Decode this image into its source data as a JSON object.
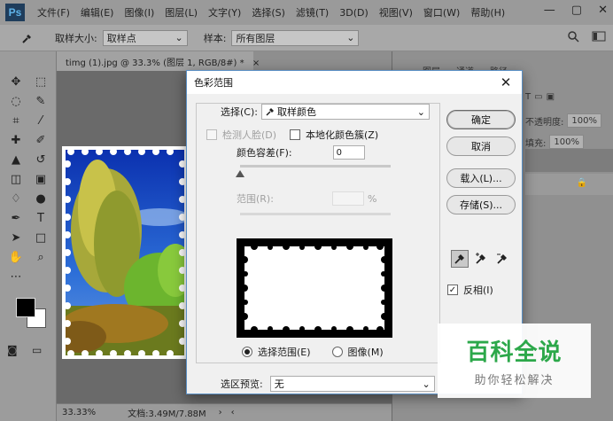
{
  "menubar": {
    "logo": "Ps",
    "items": [
      "文件(F)",
      "编辑(E)",
      "图像(I)",
      "图层(L)",
      "文字(Y)",
      "选择(S)",
      "滤镜(T)",
      "3D(D)",
      "视图(V)",
      "窗口(W)",
      "帮助(H)"
    ],
    "window_controls": [
      "—",
      "▢",
      "✕"
    ]
  },
  "optionsbar": {
    "sample_size_label": "取样大小:",
    "sample_size_value": "取样点",
    "sample_label": "样本:",
    "sample_value": "所有图层"
  },
  "document": {
    "tab_title": "timg (1).jpg @ 33.3% (图层 1, RGB/8#) *",
    "zoom": "33.33%",
    "doc_info": "文档:3.49M/7.88M"
  },
  "panels": {
    "tabs": [
      "图层",
      "通道",
      "路径"
    ],
    "opacity_label": "不透明度:",
    "opacity_value": "100%",
    "fill_label": "填充:",
    "fill_value": "100%"
  },
  "dialog": {
    "title": "色彩范围",
    "select_label": "选择(C):",
    "select_value": "取样颜色",
    "detect_faces_label": "检测人脸(D)",
    "localized_label": "本地化颜色簇(Z)",
    "fuzziness_label": "颜色容差(F):",
    "fuzziness_value": "0",
    "range_label": "范围(R):",
    "range_unit": "%",
    "radio_selection": "选择范围(E)",
    "radio_image": "图像(M)",
    "preview_label": "选区预览:",
    "preview_value": "无",
    "buttons": {
      "ok": "确定",
      "cancel": "取消",
      "load": "载入(L)...",
      "save": "存储(S)..."
    },
    "invert_label": "反相(I)",
    "invert_checked": true,
    "localized_checked": false,
    "selected_radio": "selection"
  },
  "watermark": {
    "title": "百科全说",
    "subtitle": "助你轻松解决"
  },
  "colors": {
    "accent_green": "#2ca84a",
    "dialog_border": "#5a8fc4"
  }
}
